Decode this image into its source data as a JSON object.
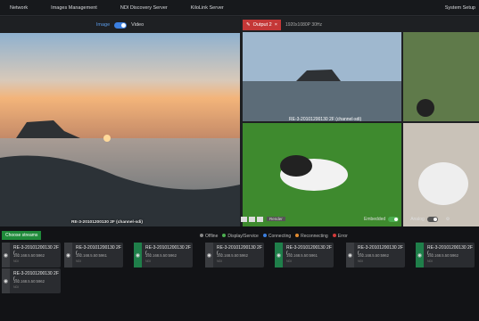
{
  "topbar": {
    "items": [
      "Network",
      "Images Management",
      "NDI Discovery Server",
      "KiloLink Server"
    ],
    "right": "System Setup"
  },
  "left": {
    "image_label": "Image",
    "video_label": "Video",
    "caption": "RE-3-20101200130 2F (channel-sdi)"
  },
  "right": {
    "output_label": "Output 2",
    "resolution": "1920x1080P 30Hz",
    "caption": "RE-3-20101200130 2F (channel-sdi)",
    "render_label": "Render",
    "embedded_label": "Embedded",
    "analog_label": "Analog"
  },
  "bottom": {
    "choose_label": "Choose streams",
    "legend": [
      {
        "label": "Offline",
        "color": "#888888"
      },
      {
        "label": "Display/Service",
        "color": "#4caf50"
      },
      {
        "label": "Connecting",
        "color": "#3b7fe0"
      },
      {
        "label": "Reconnecting",
        "color": "#e28b2f"
      },
      {
        "label": "Error",
        "color": "#d23a3a"
      }
    ],
    "cards": [
      {
        "name": "RE-3-20101200130 2F (...",
        "ip": "192.168.5.50:5962",
        "sub": "NDI",
        "green": false
      },
      {
        "name": "RE-3-20101200130 2F (...",
        "ip": "192.168.5.50:5961",
        "sub": "NDI",
        "green": false
      },
      {
        "name": "RE-3-20101200130 2F (...",
        "ip": "192.168.5.50:5962",
        "sub": "NDI",
        "green": true
      },
      {
        "name": "RE-3-20101200130 2F (...",
        "ip": "192.168.5.50:5962",
        "sub": "NDI",
        "green": false
      },
      {
        "name": "RE-3-20101200130 2F (...",
        "ip": "192.168.5.50:5961",
        "sub": "NDI",
        "green": true
      },
      {
        "name": "RE-3-20101200130 2F (...",
        "ip": "192.168.5.50:5962",
        "sub": "NDI",
        "green": false
      },
      {
        "name": "RE-3-20101200130 2F (...",
        "ip": "192.168.5.50:5962",
        "sub": "NDI",
        "green": true
      },
      {
        "name": "RE-3-20101200130 2F (...",
        "ip": "192.168.5.50:5962",
        "sub": "NDI",
        "green": false
      }
    ]
  }
}
